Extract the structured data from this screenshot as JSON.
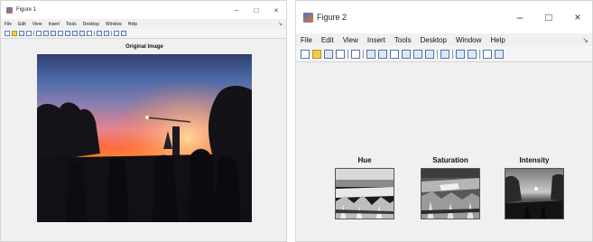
{
  "figure1": {
    "title": "Figure 1",
    "controls": {
      "minimize": "–",
      "maximize": "□",
      "close": "×"
    },
    "menu": [
      "File",
      "Edit",
      "View",
      "Insert",
      "Tools",
      "Desktop",
      "Window",
      "Help"
    ],
    "axes_title": "Original Image"
  },
  "figure2": {
    "title": "Figure 2",
    "controls": {
      "minimize": "–",
      "maximize": "□",
      "close": "×"
    },
    "menu": [
      "File",
      "Edit",
      "View",
      "Insert",
      "Tools",
      "Desktop",
      "Window",
      "Help"
    ],
    "panels": [
      {
        "title": "Hue"
      },
      {
        "title": "Saturation"
      },
      {
        "title": "Intensity"
      }
    ]
  },
  "icons": [
    "new-figure-icon",
    "open-icon",
    "save-icon",
    "print-icon",
    "pointer-icon",
    "zoom-in-icon",
    "zoom-out-icon",
    "pan-icon",
    "rotate-icon",
    "data-cursor-icon",
    "brush-icon",
    "link-icon",
    "colorbar-icon",
    "legend-icon",
    "hide-tools-icon",
    "dock-icon"
  ]
}
